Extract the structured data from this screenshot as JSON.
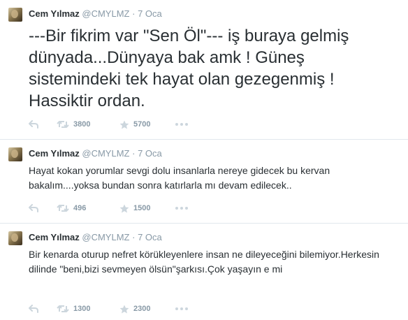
{
  "tweets": [
    {
      "name": "Cem Yılmaz",
      "handle": "@CMYLMZ",
      "separator": "·",
      "time": "7 Oca",
      "text": "---Bir fikrim var \"Sen Öl\"--- iş buraya gelmiş dünyada...Dünyaya bak amk ! Güneş sistemindeki tek hayat olan gezegenmiş ! Hassiktir ordan.",
      "retweets": "3800",
      "favorites": "5700"
    },
    {
      "name": "Cem Yılmaz",
      "handle": "@CMYLMZ",
      "separator": "·",
      "time": "7 Oca",
      "text": "Hayat kokan yorumlar sevgi dolu insanlarla nereye gidecek bu kervan bakalım....yoksa bundan sonra katırlarla mı devam edilecek..",
      "retweets": "496",
      "favorites": "1500"
    },
    {
      "name": "Cem Yılmaz",
      "handle": "@CMYLMZ",
      "separator": "·",
      "time": "7 Oca",
      "text": "Bir kenarda oturup nefret körükleyenlere insan ne dileyeceğini bilemiyor.Herkesin dilinde \"beni,bizi sevmeyen ölsün\"şarkısı.Çok yaşayın e mi",
      "retweets": "1300",
      "favorites": "2300"
    }
  ],
  "icons": {
    "reply": "reply-icon",
    "retweet": "retweet-icon",
    "favorite": "star-icon",
    "more": "more-icon"
  },
  "colors": {
    "text": "#292f33",
    "muted": "#8899a6",
    "icon": "#ccd6dd",
    "divider": "#e1e8ed"
  }
}
